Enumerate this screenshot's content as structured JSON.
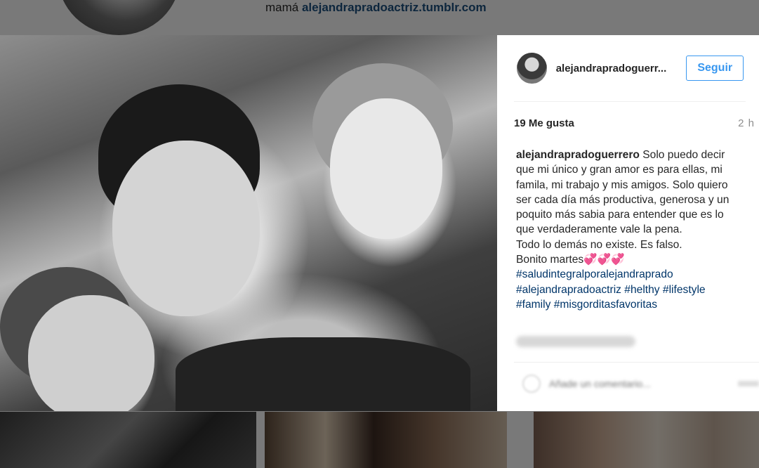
{
  "background": {
    "bio_prefix": "mamá",
    "bio_link": "alejandrapradoactriz.tumblr.com"
  },
  "post": {
    "username": "alejandrapradoguerrero",
    "username_display": "alejandrapradoguerr...",
    "follow_label": "Seguir",
    "likes": "19 Me gusta",
    "time": "2 h",
    "caption_user": "alejandrapradoguerrero",
    "caption_text": "Solo puedo decir que mi único y gran amor es para ellas, mi famila, mi trabajo y mis amigos. Solo quiero ser cada día más productiva, generosa y un poquito más sabia para entender que es lo que verdaderamente vale la pena.",
    "caption_line2": "Todo lo demás no existe. Es falso.",
    "caption_line3": "Bonito martes💞💞💞",
    "hashtags": [
      "#saludintegralporalejandraprado",
      "#alejandrapradoactriz #helthy #lifestyle",
      "#family #misgorditasfavoritas"
    ],
    "comment_placeholder": "Añade un comentario..."
  },
  "colors": {
    "follow_blue": "#3897f0",
    "hashtag": "#003569"
  },
  "icons": {
    "like": "heart-icon",
    "more": "more-options-icon"
  }
}
